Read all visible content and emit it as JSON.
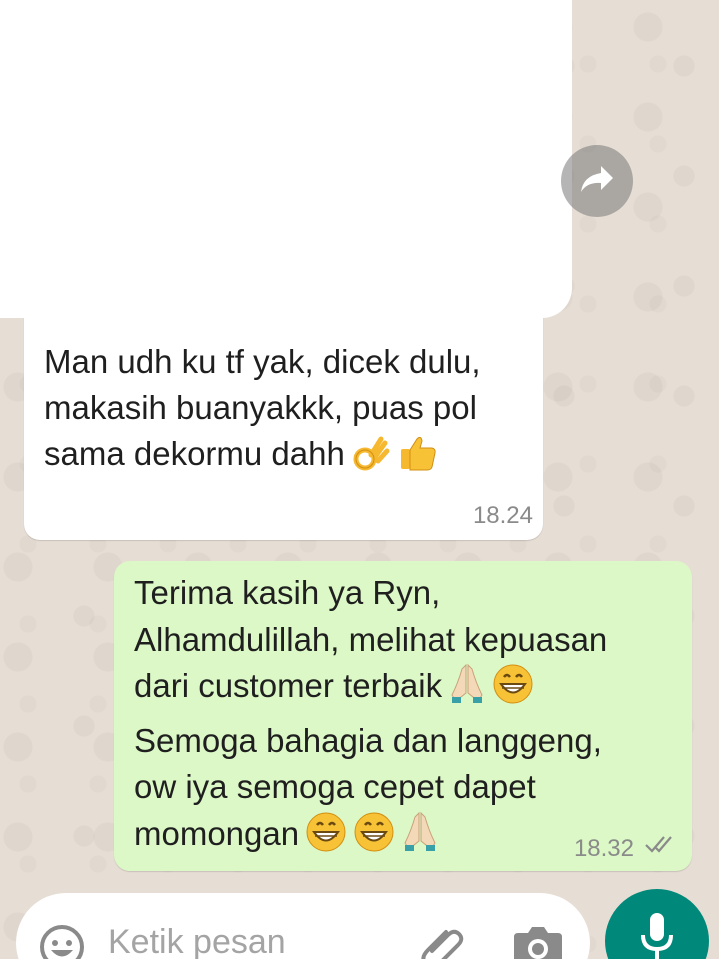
{
  "chat": {
    "incoming": {
      "lines": [
        "Man udh ku tf yak,  dicek dulu,",
        "makasih buanyakkk,  puas pol",
        "sama dekormu dahh"
      ],
      "emojis": [
        "ok-hand-emoji",
        "thumbs-up-emoji"
      ],
      "time": "18.24"
    },
    "outgoing": {
      "line1": "Terima kasih ya Ryn,",
      "line2": "Alhamdulillah, melihat kepuasan",
      "line3": "dari customer terbaik",
      "line4": "Semoga bahagia dan langgeng,",
      "line5": "ow iya semoga cepet dapet",
      "line6": "momongan",
      "time": "18.32",
      "status": "read-double-tick-icon"
    }
  },
  "composer": {
    "placeholder": "Ketik pesan"
  },
  "icons": {
    "forward": "forward-icon",
    "emoji": "emoji-icon",
    "attach": "paperclip-icon",
    "camera": "camera-icon",
    "mic": "mic-icon"
  },
  "colors": {
    "outgoing_bubble": "#dcf8c6",
    "incoming_bubble": "#ffffff",
    "accent": "#00897b",
    "wallpaper": "#e6ddd4"
  }
}
